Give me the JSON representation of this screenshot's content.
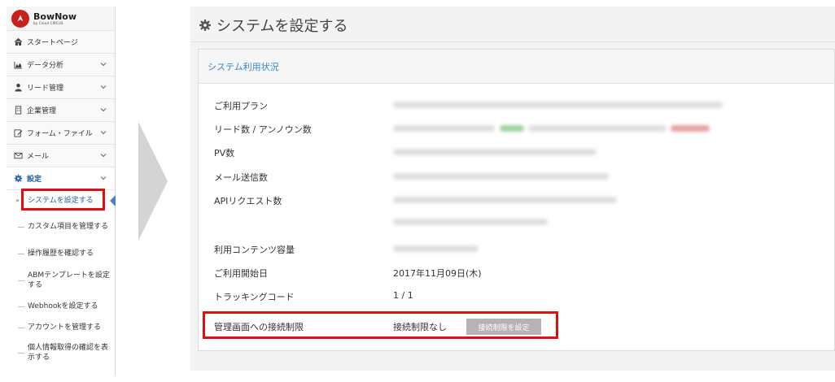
{
  "brand": {
    "name": "BowNow",
    "sub": "by Cloud CIRCUS"
  },
  "sidebar": {
    "items": [
      {
        "label": "スタートページ",
        "icon": "home-icon"
      },
      {
        "label": "データ分析",
        "icon": "area-chart-icon"
      },
      {
        "label": "リード管理",
        "icon": "user-icon"
      },
      {
        "label": "企業管理",
        "icon": "building-icon"
      },
      {
        "label": "フォーム・ファイル",
        "icon": "edit-icon"
      },
      {
        "label": "メール",
        "icon": "mail-icon"
      },
      {
        "label": "設定",
        "icon": "gear-icon"
      }
    ],
    "sub_items": [
      {
        "label": "システムを設定する"
      },
      {
        "label": "カスタム項目を管理する"
      },
      {
        "label": "操作履歴を確認する"
      },
      {
        "label": "ABMテンプレートを設定する"
      },
      {
        "label": "Webhookを設定する"
      },
      {
        "label": "アカウントを管理する"
      },
      {
        "label": "個人情報取得の確認を表示する"
      }
    ]
  },
  "main": {
    "title": "システムを設定する",
    "panel_title": "システム利用状況",
    "rows": {
      "plan": "ご利用プラン",
      "leads": "リード数 / アンノウン数",
      "pv": "PV数",
      "mail": "メール送信数",
      "api": "APIリクエスト数",
      "storage": "利用コンテンツ容量",
      "start_date": "ご利用開始日",
      "tracking": "トラッキングコード",
      "restriction": "管理画面への接続制限"
    },
    "values": {
      "start_date": "2017年11月09日(木)",
      "tracking": "1 / 1",
      "restriction": "接続制限なし"
    },
    "restriction_button": "接続制限を設定"
  },
  "colors": {
    "highlight": "#e01010",
    "accent": "#3a86c5",
    "brand": "#c8211d"
  }
}
